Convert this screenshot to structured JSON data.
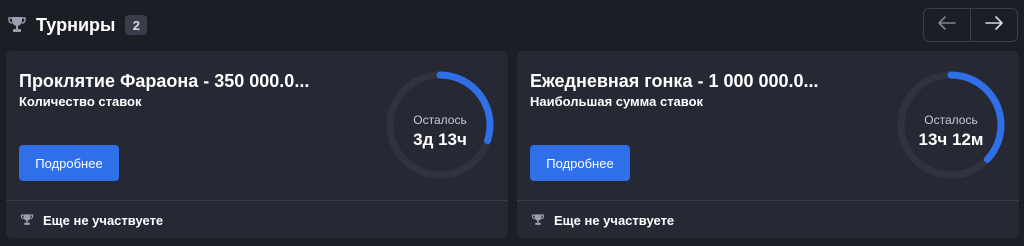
{
  "header": {
    "title": "Турниры",
    "count": "2"
  },
  "colors": {
    "accent": "#2f6fe8",
    "ring_track": "#30333d",
    "card_bg": "#262933",
    "page_bg": "#1c1e26"
  },
  "icons": {
    "trophy": "trophy-icon",
    "prev": "arrow-left-icon",
    "next": "arrow-right-icon"
  },
  "tournaments": [
    {
      "name": "Проклятие Фараона - 350 000.0...",
      "subtitle": "Количество ставок",
      "button_label": "Подробнее",
      "remaining_label": "Осталось",
      "remaining_value": "3д 13ч",
      "progress_fraction": 0.3,
      "status": "Еще не участвуете"
    },
    {
      "name": "Ежедневная гонка - 1 000 000.0...",
      "subtitle": "Наибольшая сумма ставок",
      "button_label": "Подробнее",
      "remaining_label": "Осталось",
      "remaining_value": "13ч 12м",
      "progress_fraction": 0.37,
      "status": "Еще не участвуете"
    }
  ]
}
